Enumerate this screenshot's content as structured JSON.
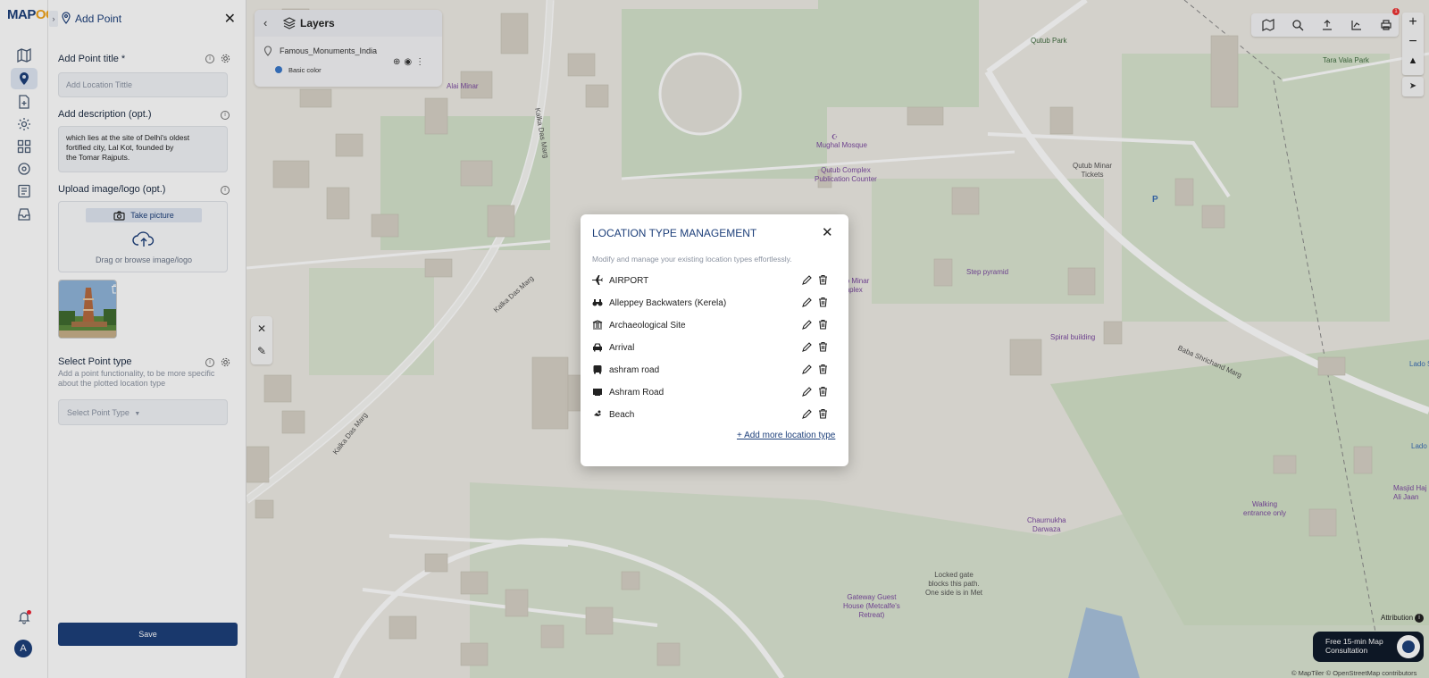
{
  "brand": {
    "logo_main": "MAP",
    "logo_accent": "OG"
  },
  "panel": {
    "title": "Add Point",
    "point_title_label": "Add Point title *",
    "point_title_placeholder": "Add Location Tittle",
    "description_label": "Add description (opt.)",
    "description_lines": [
      "which lies at the site of Delhi's oldest",
      "fortified city, Lal Kot, founded by",
      "the Tomar Rajputs."
    ],
    "upload_label": "Upload image/logo (opt.)",
    "take_picture": "Take picture",
    "drag_text": "Drag or browse image/logo",
    "select_type_label": "Select Point type",
    "select_type_helper": "Add a point functionality, to be more specific about the plotted location type",
    "select_type_placeholder": "Select Point Type",
    "save_label": "Save"
  },
  "user": {
    "avatar_initial": "A"
  },
  "layers": {
    "title": "Layers",
    "layer_name": "Famous_Monuments_India",
    "color_label": "Basic color"
  },
  "modal": {
    "title": "LOCATION TYPE MANAGEMENT",
    "subtitle": "Modify and manage your existing location types effortlessly.",
    "items": [
      {
        "label": "AIRPORT",
        "icon": "airplane-icon"
      },
      {
        "label": "Alleppey Backwaters (Kerela)",
        "icon": "binoculars-icon"
      },
      {
        "label": "Archaeological Site",
        "icon": "temple-icon"
      },
      {
        "label": "Arrival",
        "icon": "car-icon"
      },
      {
        "label": "ashram road",
        "icon": "bus-icon"
      },
      {
        "label": "Ashram Road",
        "icon": "screen-icon"
      },
      {
        "label": "Beach",
        "icon": "swimmer-icon"
      }
    ],
    "add_more": "+ Add more location type"
  },
  "map": {
    "labels": {
      "alai_minar": "Alai Minar",
      "mughal_mosque": "Mughal Mosque",
      "qutub_complex": "Qutub Complex\nPublication Counter",
      "qutub_park": "Qutub Park",
      "tara_vala": "Tara Vala Park",
      "qutub_tickets": "Qutub Minar\nTickets",
      "step_pyramid": "Step pyramid",
      "qutub_minar_complex": "tub Minar\nomplex",
      "spiral_building": "Spiral building",
      "chaurnukha": "Chaurnukha\nDarwaza",
      "walking": "Walking\nentrance only",
      "masjid": "Masjid Haj\nAli Jaan",
      "locked_gate": "Locked gate\nblocks this path.\nOne side is in Met",
      "guest_house": "Gateway Guest\nHouse (Metcalfe's\nRetreat)",
      "lado1": "Lado S",
      "lado2": "Lado",
      "parking": "P"
    },
    "roads": {
      "kalka1": "Kalka Das Marg",
      "kalka2": "Kalka Das Marg",
      "kalka3": "Kalka Das Marg",
      "baba": "Baba Shrichand Marg"
    },
    "attribution": "Attribution",
    "copyright": "© MapTiler © OpenStreetMap contributors"
  },
  "consult": {
    "line1": "Free 15-min Map",
    "line2": "Consultation"
  },
  "badge_count": "1",
  "colors": {
    "accent": "#1d3f7a",
    "brand_orange": "#f0a31a",
    "layer_dot": "#3a78c9"
  }
}
